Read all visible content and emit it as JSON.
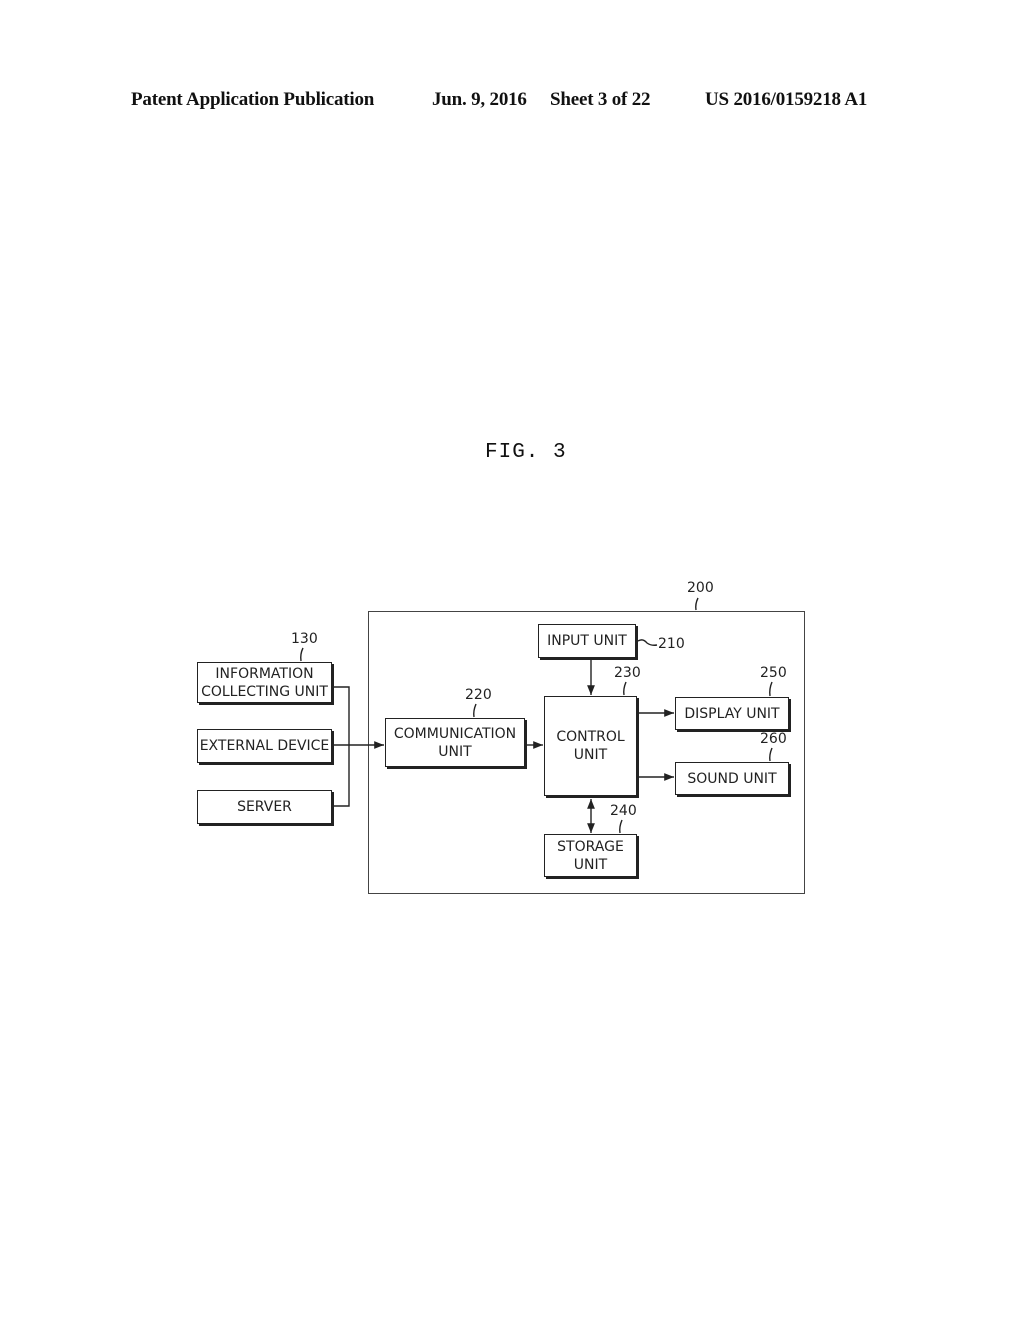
{
  "header": {
    "publication": "Patent Application Publication",
    "date": "Jun. 9, 2016",
    "sheet": "Sheet 3 of 22",
    "number": "US 2016/0159218 A1"
  },
  "figure": {
    "title": "FIG. 3"
  },
  "diagram": {
    "container": {
      "ref": "200"
    },
    "external": [
      {
        "id": "info",
        "label": "INFORMATION COLLECTING UNIT",
        "ref": "130"
      },
      {
        "id": "ext",
        "label": "EXTERNAL DEVICE"
      },
      {
        "id": "server",
        "label": "SERVER"
      }
    ],
    "units": {
      "input": {
        "label": "INPUT UNIT",
        "ref": "210"
      },
      "communication": {
        "label": "COMMUNICATION UNIT",
        "ref": "220"
      },
      "control": {
        "label": "CONTROL UNIT",
        "ref": "230"
      },
      "storage": {
        "label": "STORAGE UNIT",
        "ref": "240"
      },
      "display": {
        "label": "DISPLAY UNIT",
        "ref": "250"
      },
      "sound": {
        "label": "SOUND UNIT",
        "ref": "260"
      }
    },
    "connections": [
      {
        "from": "info",
        "to": "communication"
      },
      {
        "from": "ext",
        "to": "communication"
      },
      {
        "from": "server",
        "to": "communication"
      },
      {
        "from": "communication",
        "to": "control"
      },
      {
        "from": "input",
        "to": "control"
      },
      {
        "from": "control",
        "to": "display"
      },
      {
        "from": "control",
        "to": "sound"
      },
      {
        "from": "control",
        "to": "storage",
        "bidirectional": true
      }
    ]
  }
}
